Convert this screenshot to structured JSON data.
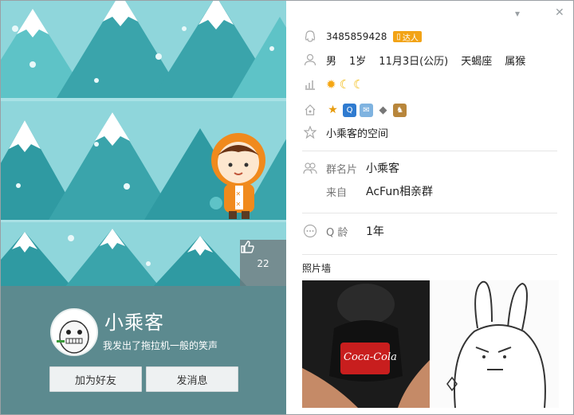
{
  "window": {
    "minimize_icon": "chevron-down-icon",
    "close_icon": "close-icon",
    "minimize_glyph": "▾",
    "close_glyph": "✕"
  },
  "profile": {
    "nickname": "小乘客",
    "signature": "我发出了拖拉机一般的笑声",
    "likes": "22",
    "add_friend_label": "加为好友",
    "send_message_label": "发消息"
  },
  "details": {
    "qq_number": "3485859428",
    "daren_badge": "达人",
    "gender": "男",
    "age": "1岁",
    "birthday": "11月3日(公历)",
    "zodiac": "天蝎座",
    "chinese_zodiac": "属猴",
    "level_icons": [
      "sun-icon",
      "moon-icon",
      "moon-icon"
    ],
    "service_icons": [
      "star-icon",
      "qq-show-icon",
      "mail-icon",
      "diamond-icon",
      "game-icon"
    ],
    "space_link": "小乘客的空间",
    "group_card_label": "群名片",
    "group_card_value": "小乘客",
    "from_label": "来自",
    "from_value": "AcFun相亲群",
    "q_age_label": "Q 龄",
    "q_age_value": "1年",
    "photo_wall_title": "照片墙"
  },
  "colors": {
    "accent_panel": "#5c8a8f",
    "cover_bg": "#8fd6db",
    "daren": "#f2a316"
  }
}
